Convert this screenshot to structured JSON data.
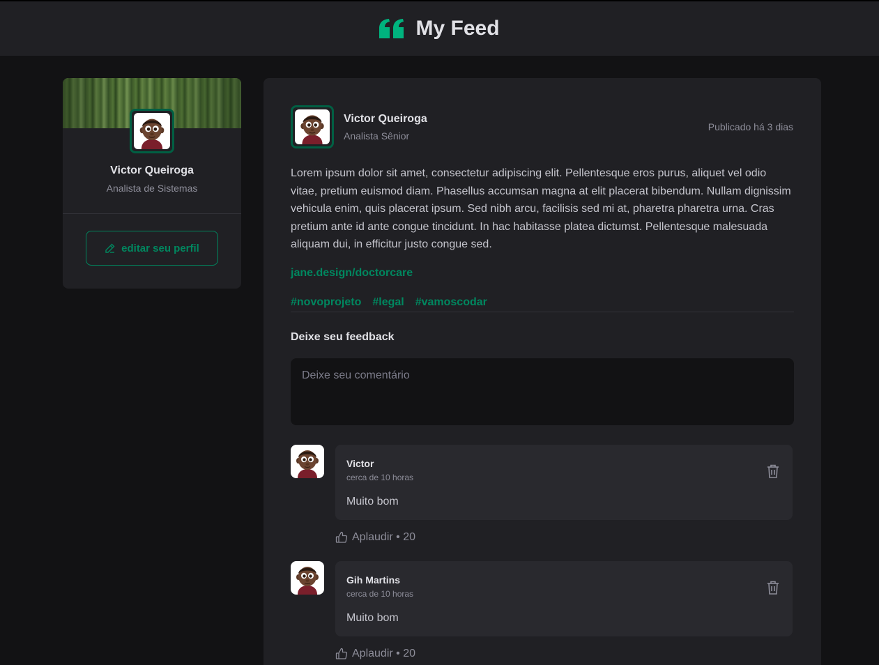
{
  "header": {
    "title": "My Feed",
    "logo_icon": "quote-icon",
    "accent": "#00b37e"
  },
  "sidebar": {
    "name": "Victor Queiroga",
    "role": "Analista de Sistemas",
    "edit_label": "editar seu perfil"
  },
  "post": {
    "author": {
      "name": "Victor Queiroga",
      "role": "Analista Sênior"
    },
    "published": "Publicado há 3 dias",
    "content": "Lorem ipsum dolor sit amet, consectetur adipiscing elit. Pellentesque eros purus, aliquet vel odio vitae, pretium euismod diam. Phasellus accumsan magna at elit placerat bibendum. Nullam dignissim vehicula enim, quis placerat ipsum. Sed nibh arcu, facilisis sed mi at, pharetra pharetra urna. Cras pretium ante id ante congue tincidunt. In hac habitasse platea dictumst. Pellentesque malesuada aliquam dui, in efficitur justo congue sed.",
    "link": "jane.design/doctorcare",
    "tags": [
      "#novoprojeto",
      "#legal",
      "#vamoscodar"
    ],
    "feedback_title": "Deixe seu feedback",
    "comment_placeholder": "Deixe seu comentário"
  },
  "comments": [
    {
      "name": "Victor",
      "time": "cerca de 10 horas",
      "text": "Muito bom",
      "applaud": "Aplaudir • 20"
    },
    {
      "name": "Gih Martins",
      "time": "cerca de 10 horas",
      "text": "Muito bom",
      "applaud": "Aplaudir • 20"
    }
  ],
  "colors": {
    "background": "#121214",
    "card": "#202024",
    "comment": "#29292e",
    "green": "#00875f",
    "border_green": "#015f43"
  }
}
